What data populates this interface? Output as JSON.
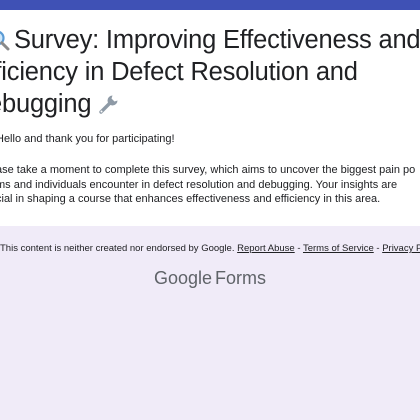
{
  "header": {
    "title_line1": "Survey: Improving Effectiveness and",
    "title_line2": "fficiency in Defect Resolution and",
    "title_line3": "ebugging",
    "accent_color": "#3f51b5",
    "leading_icon": "magnifying-glass-icon",
    "trailing_icon": "wrench-icon"
  },
  "body": {
    "greeting": "Hello and thank you for participating!",
    "desc_line1": "ase take a moment to complete this survey, which aims to uncover the biggest pain po",
    "desc_line2": "ms and individuals encounter in defect resolution and debugging. Your insights are",
    "desc_line3": "cial in shaping a course that enhances effectiveness and efficiency in this area."
  },
  "footer": {
    "disclaimer": "This content is neither created nor endorsed by Google.",
    "report_abuse": "Report Abuse",
    "separator": "-",
    "terms": "Terms of Service",
    "privacy": "Privacy Policy"
  },
  "branding": {
    "brand": "Google",
    "product": "Forms"
  }
}
